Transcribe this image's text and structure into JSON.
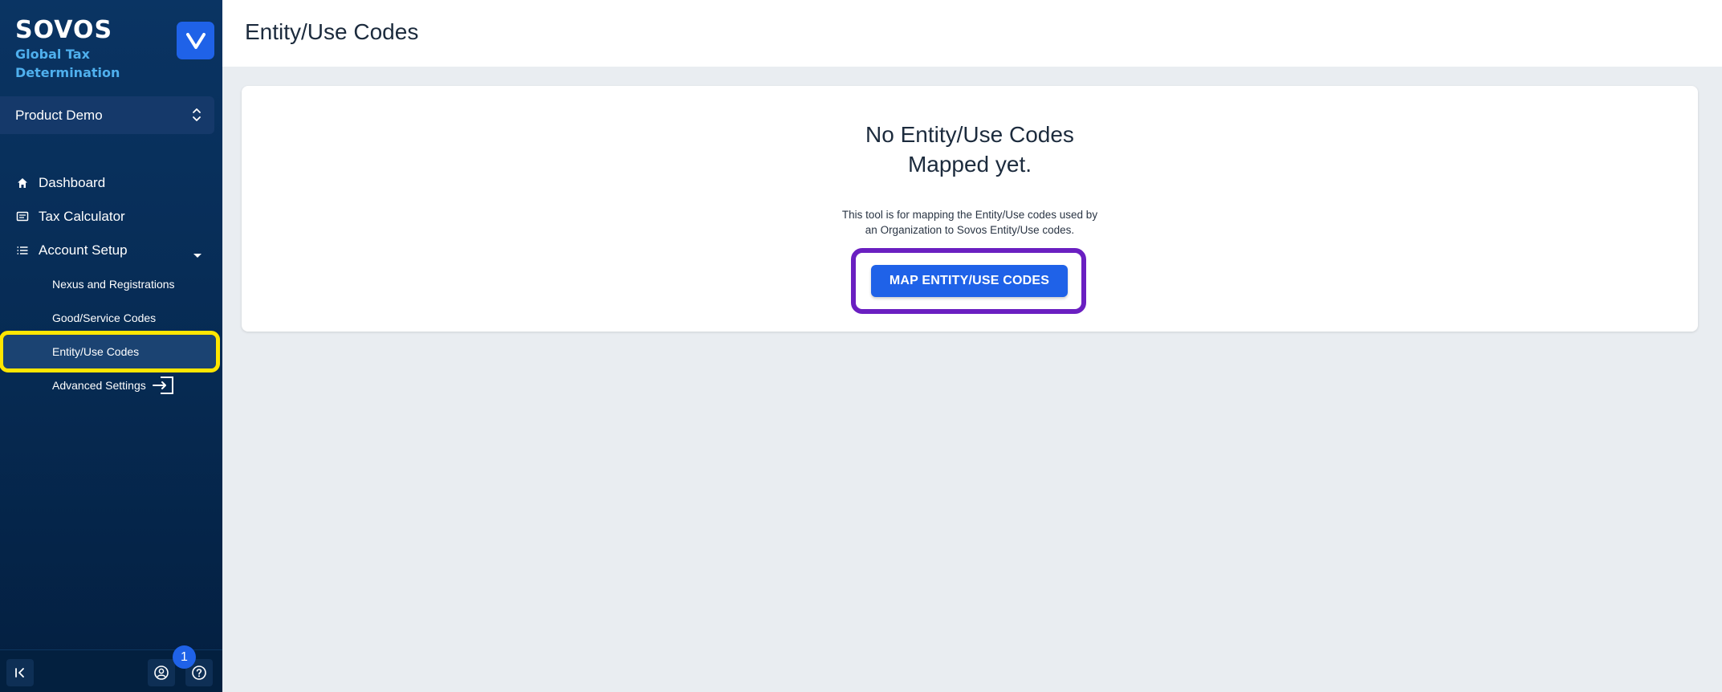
{
  "brand": {
    "logo": "SOVOS",
    "product": "Global Tax Determination",
    "app_icon": "v-logo-icon"
  },
  "org_selector": {
    "value": "Product Demo"
  },
  "nav": {
    "items": [
      {
        "label": "Dashboard",
        "icon": "home-icon"
      },
      {
        "label": "Tax Calculator",
        "icon": "calculator-icon"
      },
      {
        "label": "Account Setup",
        "icon": "list-icon"
      }
    ],
    "sub_items": [
      {
        "label": "Nexus and Registrations"
      },
      {
        "label": "Good/Service Codes"
      },
      {
        "label": "Entity/Use Codes"
      },
      {
        "label": "Advanced Settings",
        "icon": "external-link-icon"
      }
    ]
  },
  "footer": {
    "notification_count": "1"
  },
  "page": {
    "title": "Entity/Use Codes",
    "empty_title_line1": "No Entity/Use Codes",
    "empty_title_line2": "Mapped yet.",
    "description_line1": "This tool is for mapping the Entity/Use codes used by",
    "description_line2": "an Organization to Sovos Entity/Use codes.",
    "cta_label": "MAP ENTITY/USE CODES"
  },
  "colors": {
    "accent": "#1f62e8",
    "sidebar": "#062a52",
    "highlight_yellow": "#ffe600",
    "highlight_purple": "#6a1fc1"
  }
}
